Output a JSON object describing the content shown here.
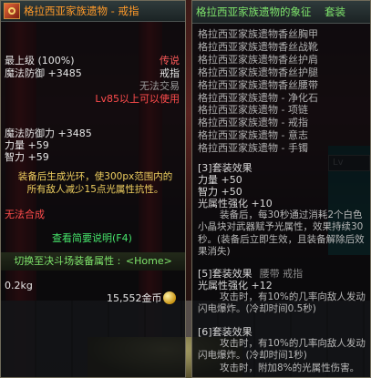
{
  "item": {
    "title": "格拉西亚家族遗物 - 戒指",
    "grade": "最上级 (100%)",
    "rarity": "传说",
    "slot": "戒指",
    "trade": "无法交易",
    "level_req": "Lv85以上可以使用",
    "magic_def_line1": "魔法防御 +3485",
    "magic_def_line2": "魔法防御力 +3485",
    "str": "力量 +59",
    "int": "智力 +59",
    "description": "装备后生成光环，使300px范围内的所有敌人减少15点光属性抗性。",
    "no_synth": "无法合成",
    "view_desc": "查看简要说明(F4)",
    "switch_label": "切换至决斗场装备属性 :",
    "switch_key": "<Home>",
    "weight": "0.2kg",
    "price": "15,552金币"
  },
  "set": {
    "title": "格拉西亚家族遗物的象征",
    "tag": "套装",
    "pieces": [
      "格拉西亚家族遗物香丝胸甲",
      "格拉西亚家族遗物香丝战靴",
      "格拉西亚家族遗物香丝护肩",
      "格拉西亚家族遗物香丝护腿",
      "格拉西亚家族遗物香丝腰带",
      "格拉西亚家族遗物 - 净化石",
      "格拉西亚家族遗物 - 项链",
      "格拉西亚家族遗物 - 戒指",
      "格拉西亚家族遗物 - 意志",
      "格拉西亚家族遗物 - 手镯"
    ],
    "bonus3": {
      "header": "[3]套装效果",
      "str": "力量 +50",
      "int": "智力 +50",
      "light": "光属性强化 +10",
      "text": "装备后，每30秒通过消耗2个白色小晶块对武器赋予光属性，效果持续30秒。(装备后立即生效，且装备解除后效果消失)"
    },
    "bonus5": {
      "header": "[5]套装效果",
      "overlay": "腰带 戒指",
      "light": "光属性强化 +12",
      "text": "攻击时，有10%的几率向敌人发动闪电爆炸。(冷却时间0.5秒)"
    },
    "bonus6": {
      "header": "[6]套装效果",
      "text1": "攻击时，有10%的几率向敌人发动闪电爆炸。(冷却时间1秒)",
      "text2": "攻击时，附加8%的光属性伤害。"
    }
  },
  "ui": {
    "dropdown": "Lv"
  }
}
